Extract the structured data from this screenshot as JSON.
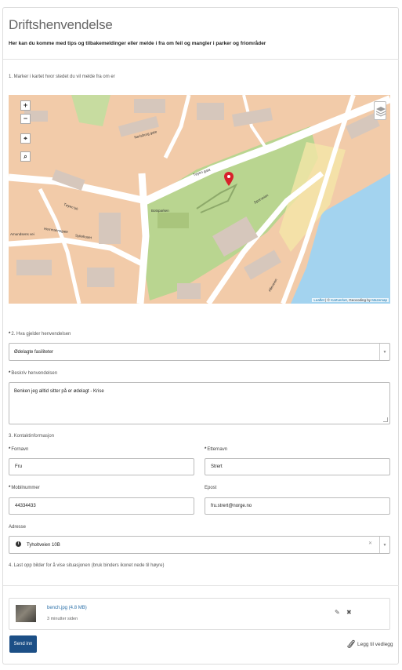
{
  "form": {
    "title": "Driftshenvendelse",
    "subtitle": "Her kan du komme med tips og tilbakemeldinger eller melde i fra om feil og mangler i parker og friområder"
  },
  "map_section": {
    "label": "1. Marker i kartet hvor stedet du vil melde fra om er",
    "zoom_in": "+",
    "zoom_out": "−",
    "attribution_leaflet": "Leaflet",
    "attribution_sep1": " | © ",
    "attribution_kartverket": "Kartverket",
    "attribution_mid": ", Geocoding by ",
    "attribution_mazemap": "Mazemap",
    "street_labels": [
      "Nerisburg gate",
      "Tøyen gata",
      "Botsparken",
      "Amundsens vei",
      "Sporveien",
      "Herrmannsgate",
      "Sykehuset",
      "Tøyen bh",
      "Alleveien"
    ]
  },
  "category": {
    "label": "2. Hva gjelder henvendelsen",
    "value": "Ødelagte fasiliteter"
  },
  "description": {
    "label": "Beskriv henvendelsen",
    "value": "Benken jeg alltid sitter på er ødelagt - Krise"
  },
  "contact": {
    "label": "3. Kontaktinformasjon",
    "firstname_label": "Fornavn",
    "firstname_value": "Fru",
    "lastname_label": "Etternavn",
    "lastname_value": "Strert",
    "mobile_label": "Mobilnummer",
    "mobile_value": "44334433",
    "email_label": "Epost",
    "email_value": "fru.strert@norge.no",
    "address_label": "Adresse",
    "address_value": "Tyholtveien 10B"
  },
  "upload": {
    "label": "4. Last opp bilder for å vise situasjonen (bruk binders ikonet nede til høyre)",
    "file_name": "bench.jpg (4.8 MB)",
    "file_time": "3 minutter siden",
    "add_attachment": "Legg til vedlegg"
  },
  "actions": {
    "send_label": "Send inn"
  },
  "colors": {
    "map_marker": "#d8202a",
    "park_green": "#b8d48e",
    "water": "#9dd0ee",
    "primary_button": "#1c4f86"
  }
}
